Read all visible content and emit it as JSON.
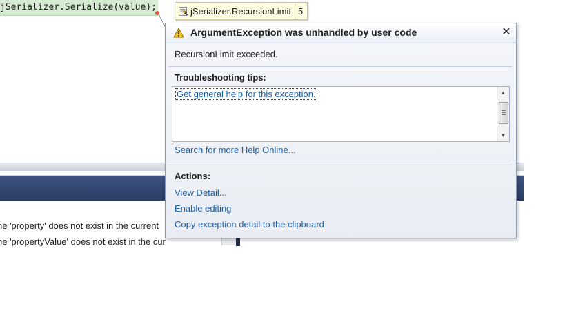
{
  "editor": {
    "code_line": "jSerializer.Serialize(value);"
  },
  "datatip": {
    "icon": "property-icon",
    "name": "jSerializer.RecursionLimit",
    "value": "5"
  },
  "exception": {
    "title": "ArgumentException was unhandled by user code",
    "message": "RecursionLimit exceeded.",
    "tips_heading": "Troubleshooting tips:",
    "tips_link": "Get general help for this exception.",
    "search_link": "Search for more Help Online...",
    "actions_heading": "Actions:",
    "actions": [
      "View Detail...",
      "Enable editing",
      "Copy exception detail to the clipboard"
    ],
    "close_icon": "close-icon",
    "warning_icon": "warning-icon"
  },
  "error_list": {
    "rows": [
      "he 'property' does not exist in the current",
      "he 'propertyValue' does not exist in the cur"
    ]
  },
  "colors": {
    "link": "#1b5ea8",
    "code_highlight": "#d6ecd2",
    "pane_header": "#2b3c62"
  }
}
